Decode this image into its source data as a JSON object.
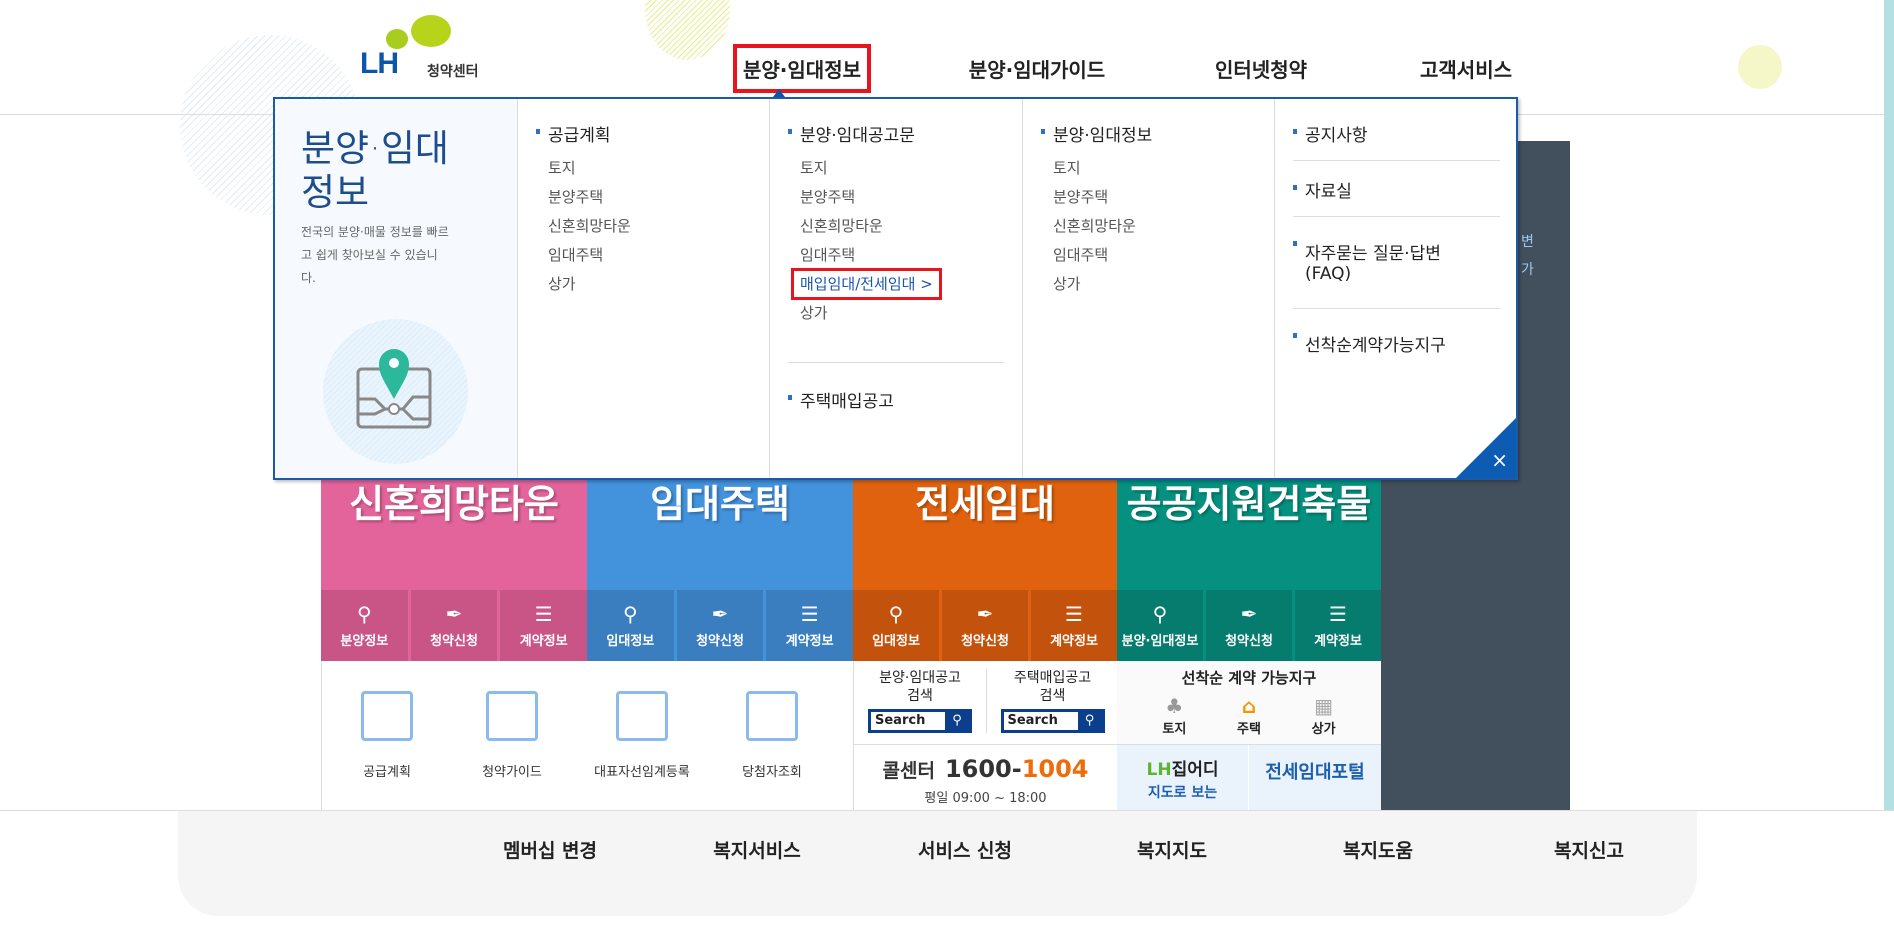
{
  "logo": {
    "mark": "LH",
    "name": "청약센터"
  },
  "nav": [
    {
      "label": "분양·임대정보",
      "active": true
    },
    {
      "label": "분양·임대가이드"
    },
    {
      "label": "인터넷청약"
    },
    {
      "label": "고객서비스"
    }
  ],
  "dropdown": {
    "title": "분양·임대 정보",
    "description": "전국의 분양·매물 정보를 빠르고 쉽게 찾아보실 수 있습니다.",
    "columns": [
      {
        "heading": "공급계획",
        "items": [
          "토지",
          "분양주택",
          "신혼희망타운",
          "임대주택",
          "상가"
        ]
      },
      {
        "heading": "분양·임대공고문",
        "items": [
          "토지",
          "분양주택",
          "신혼희망타운",
          "임대주택",
          "매입임대/전세임대 >",
          "상가"
        ],
        "highlighted": "매입임대/전세임대 >",
        "heading2": "주택매입공고"
      },
      {
        "heading": "분양·임대정보",
        "items": [
          "토지",
          "분양주택",
          "신혼희망타운",
          "임대주택",
          "상가"
        ]
      },
      {
        "links": [
          "공지사항",
          "자료실",
          "자주묻는 질문·답변 (FAQ)",
          "선착순계약가능지구"
        ]
      }
    ],
    "close": "×"
  },
  "side_panel": {
    "fragments": [
      "변",
      "가"
    ]
  },
  "tiles": [
    {
      "title": "신혼희망타운",
      "color": "#e2649a",
      "sub_color": "#c95586",
      "subs": [
        "분양정보",
        "청약신청",
        "계약정보"
      ]
    },
    {
      "title": "임대주택",
      "color": "#4392dc",
      "sub_color": "#3a7ec0",
      "subs": [
        "임대정보",
        "청약신청",
        "계약정보"
      ]
    },
    {
      "title": "매입임대\n전세임대",
      "color": "#e0620e",
      "sub_color": "#c3530c",
      "subs": [
        "임대정보",
        "청약신청",
        "계약정보"
      ]
    },
    {
      "title": "상가\n공공지원건축물",
      "color": "#05907f",
      "sub_color": "#067c6e",
      "subs": [
        "분양·임대정보",
        "청약신청",
        "계약정보"
      ]
    }
  ],
  "quick_links": [
    "공급계획",
    "청약가이드",
    "대표자선임계등록",
    "당첨자조회"
  ],
  "search_boxes": [
    {
      "label": "분양·임대공고\n검색",
      "button": "Search"
    },
    {
      "label": "주택매입공고\n검색",
      "button": "Search"
    }
  ],
  "first_come": {
    "title": "선착순 계약 가능지구",
    "items": [
      "토지",
      "주택",
      "상가"
    ]
  },
  "call_center": {
    "label": "콜센터",
    "number_a": "1600-",
    "number_b": "1004",
    "hours": "평일 09:00 ~ 18:00"
  },
  "zipeodi": {
    "brand": "LH",
    "name": "집어디",
    "sub": "지도로 보는"
  },
  "portal": {
    "name": "전세임대포털"
  },
  "footer": [
    "멤버십 변경",
    "복지서비스",
    "서비스 신청",
    "복지지도",
    "복지도움",
    "복지신고"
  ]
}
